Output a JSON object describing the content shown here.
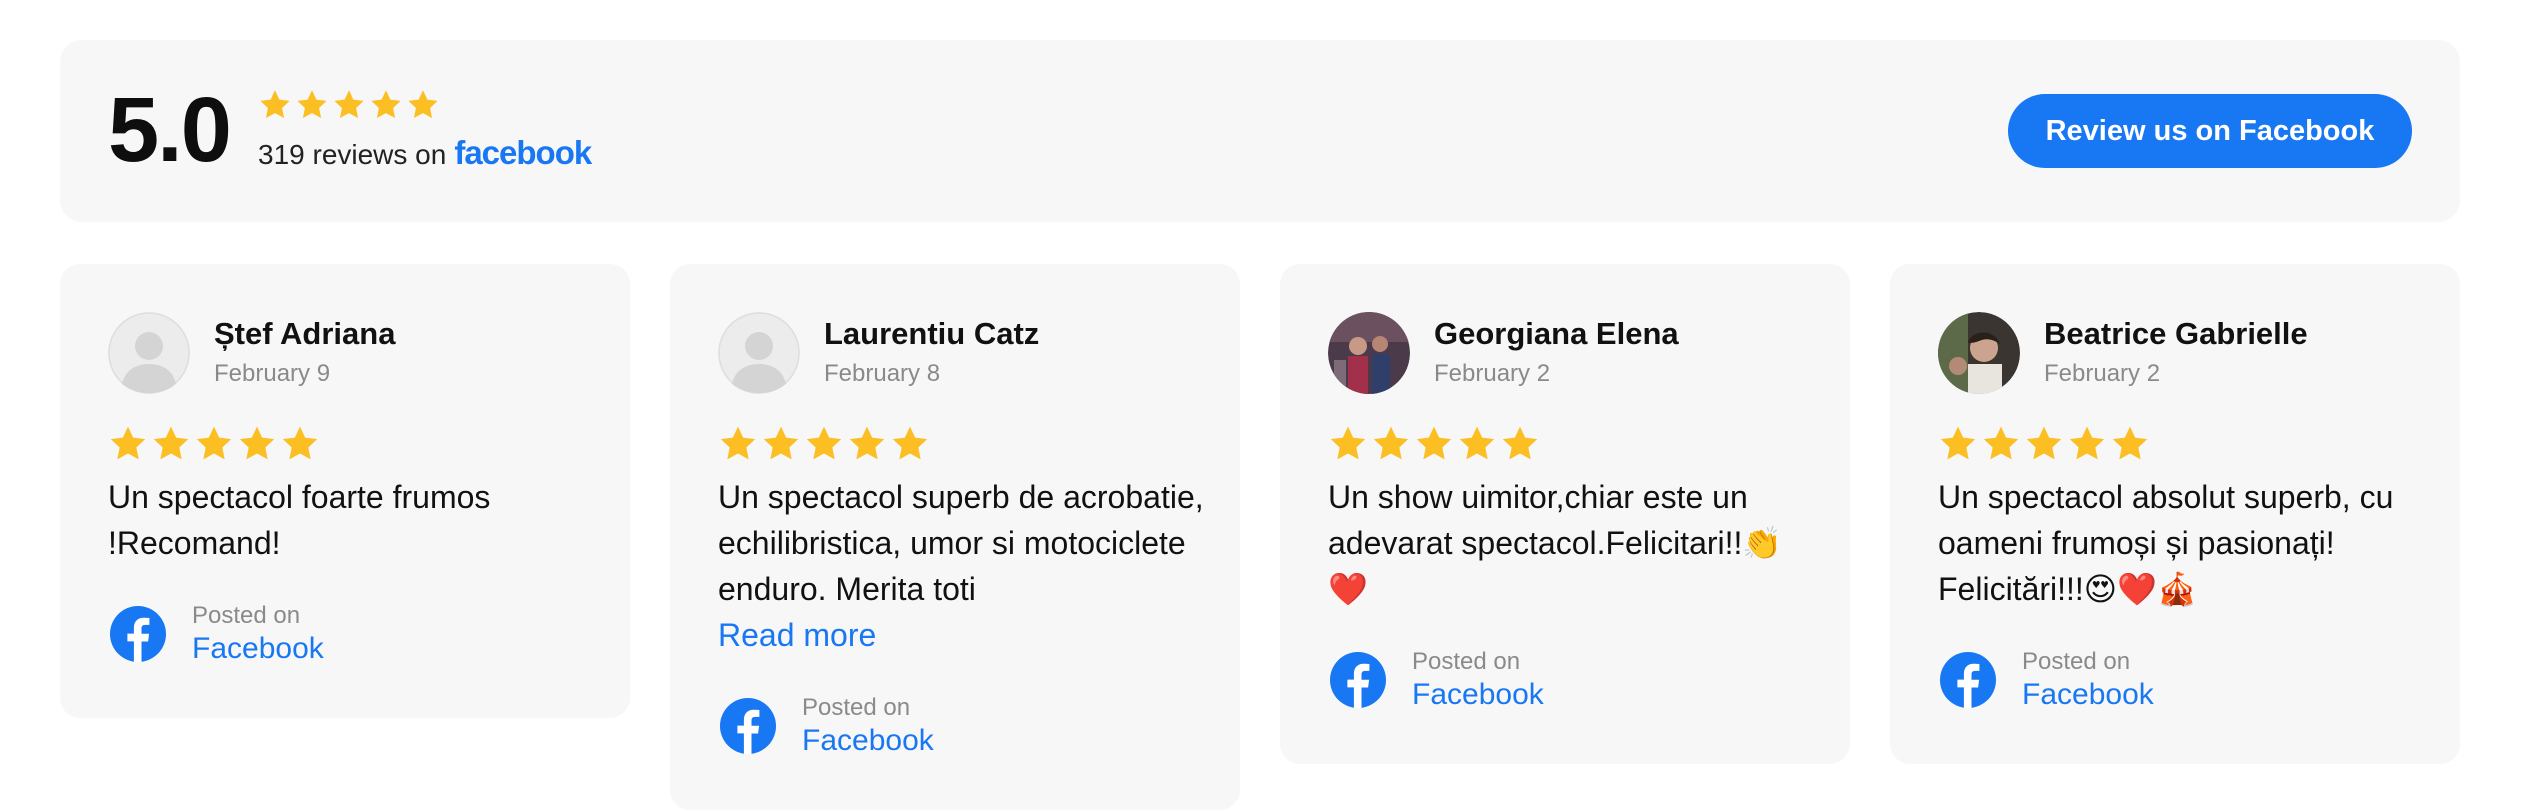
{
  "summary": {
    "score": "5.0",
    "rating": 5,
    "reviews_prefix": "319 reviews on",
    "platform_wordmark": "facebook",
    "review_button_label": "Review us on Facebook"
  },
  "colors": {
    "star": "#FBBF24",
    "facebook_blue": "#1877F2",
    "card_bg": "#F7F7F7"
  },
  "icons": {
    "star": "star-icon",
    "facebook": "facebook-icon",
    "avatar_placeholder": "user-placeholder-icon"
  },
  "reviews": [
    {
      "name": "Ștef Adriana",
      "date": "February 9",
      "rating": 5,
      "text": "Un spectacol foarte frumos !Recomand!",
      "read_more": "",
      "posted_label": "Posted on",
      "posted_link": "Facebook"
    },
    {
      "name": "Laurentiu Catz",
      "date": "February 8",
      "rating": 5,
      "text": "Un spectacol superb de acrobatie, echilibristica, umor si motociclete enduro. Merita toti",
      "read_more": "Read more",
      "posted_label": "Posted on",
      "posted_link": "Facebook"
    },
    {
      "name": "Georgiana Elena",
      "date": "February 2",
      "rating": 5,
      "text": "Un show uimitor,chiar este un adevarat spectacol.Felicitari!!👏❤️",
      "read_more": "",
      "posted_label": "Posted on",
      "posted_link": "Facebook"
    },
    {
      "name": "Beatrice Gabrielle",
      "date": "February 2",
      "rating": 5,
      "text": "Un spectacol absolut superb, cu oameni frumoși și pasionați! Felicitări!!!😍❤️🎪",
      "read_more": "",
      "posted_label": "Posted on",
      "posted_link": "Facebook"
    }
  ]
}
